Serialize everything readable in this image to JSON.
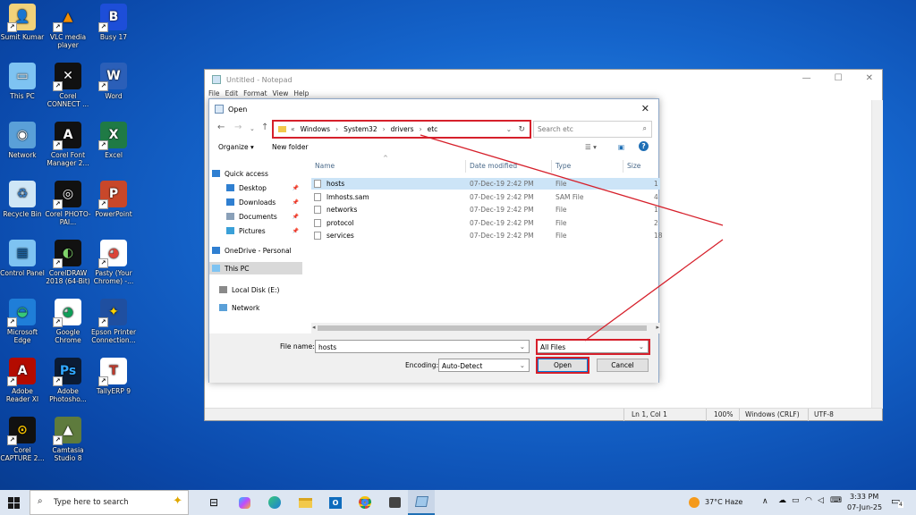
{
  "desktop": {
    "icons": [
      {
        "label": "Sumit Kumar",
        "icon": "user-folder-icon"
      },
      {
        "label": "VLC media player",
        "icon": "vlc-icon"
      },
      {
        "label": "Busy 17",
        "icon": "busy-icon"
      },
      {
        "label": "This PC",
        "icon": "this-pc-icon"
      },
      {
        "label": "Corel CONNECT ...",
        "icon": "corel-connect-icon"
      },
      {
        "label": "Word",
        "icon": "word-icon"
      },
      {
        "label": "Network",
        "icon": "network-icon"
      },
      {
        "label": "Corel Font Manager 2...",
        "icon": "corel-font-icon"
      },
      {
        "label": "Excel",
        "icon": "excel-icon"
      },
      {
        "label": "Recycle Bin",
        "icon": "recycle-bin-icon"
      },
      {
        "label": "Corel PHOTO-PAI...",
        "icon": "corel-photo-icon"
      },
      {
        "label": "PowerPoint",
        "icon": "powerpoint-icon"
      },
      {
        "label": "Control Panel",
        "icon": "control-panel-icon"
      },
      {
        "label": "CorelDRAW 2018 (64-Bit)",
        "icon": "coreldraw-icon"
      },
      {
        "label": "Pasty (Your Chrome) -...",
        "icon": "chrome-app-icon"
      },
      {
        "label": "Microsoft Edge",
        "icon": "edge-icon"
      },
      {
        "label": "Google Chrome",
        "icon": "chrome-icon"
      },
      {
        "label": "Epson Printer Connection...",
        "icon": "epson-icon"
      },
      {
        "label": "Adobe Reader XI",
        "icon": "adobe-reader-icon"
      },
      {
        "label": "Adobe Photosho...",
        "icon": "photoshop-icon"
      },
      {
        "label": "TallyERP 9",
        "icon": "tally-icon"
      },
      {
        "label": "Corel CAPTURE 2...",
        "icon": "corel-capture-icon"
      },
      {
        "label": "Camtasia Studio 8",
        "icon": "camtasia-icon"
      }
    ]
  },
  "notepad": {
    "title": "Untitled - Notepad",
    "menu": [
      "File",
      "Edit",
      "Format",
      "View",
      "Help"
    ],
    "status": {
      "position": "Ln 1, Col 1",
      "zoom": "100%",
      "eol": "Windows (CRLF)",
      "encoding": "UTF-8"
    }
  },
  "dialog": {
    "title": "Open",
    "address": {
      "chevron": "«",
      "crumbs": [
        "Windows",
        "System32",
        "drivers",
        "etc"
      ]
    },
    "search_placeholder": "Search etc",
    "toolbar": {
      "organize": "Organize ▾",
      "new_folder": "New folder"
    },
    "sidebar": [
      {
        "label": "Quick access",
        "icon": "star-icon",
        "pinned": false
      },
      {
        "label": "Desktop",
        "icon": "desktop-icon",
        "pinned": true
      },
      {
        "label": "Downloads",
        "icon": "download-icon",
        "pinned": true
      },
      {
        "label": "Documents",
        "icon": "documents-icon",
        "pinned": true
      },
      {
        "label": "Pictures",
        "icon": "pictures-icon",
        "pinned": true
      },
      {
        "label": "OneDrive - Personal",
        "icon": "cloud-icon",
        "pinned": false
      },
      {
        "label": "This PC",
        "icon": "computer-icon",
        "pinned": false
      },
      {
        "label": "Local Disk (E:)",
        "icon": "drive-icon",
        "pinned": false
      },
      {
        "label": "Network",
        "icon": "network-icon",
        "pinned": false
      }
    ],
    "columns": {
      "name": "Name",
      "date": "Date modified",
      "type": "Type",
      "size": "Size"
    },
    "files": [
      {
        "name": "hosts",
        "date": "07-Dec-19 2:42 PM",
        "type": "File",
        "size": "1",
        "selected": true
      },
      {
        "name": "lmhosts.sam",
        "date": "07-Dec-19 2:42 PM",
        "type": "SAM File",
        "size": "4",
        "selected": false
      },
      {
        "name": "networks",
        "date": "07-Dec-19 2:42 PM",
        "type": "File",
        "size": "1",
        "selected": false
      },
      {
        "name": "protocol",
        "date": "07-Dec-19 2:42 PM",
        "type": "File",
        "size": "2",
        "selected": false
      },
      {
        "name": "services",
        "date": "07-Dec-19 2:42 PM",
        "type": "File",
        "size": "18",
        "selected": false
      }
    ],
    "filename_label": "File name:",
    "filename_value": "hosts",
    "filter_value": "All Files",
    "encoding_label": "Encoding:",
    "encoding_value": "Auto-Detect",
    "open_label": "Open",
    "cancel_label": "Cancel"
  },
  "annotation_color": "#d6202b",
  "taskbar": {
    "search_placeholder": "Type here to search",
    "weather": "37°C  Haze",
    "time": "3:33 PM",
    "date": "07-Jun-25",
    "notification_count": "4"
  }
}
